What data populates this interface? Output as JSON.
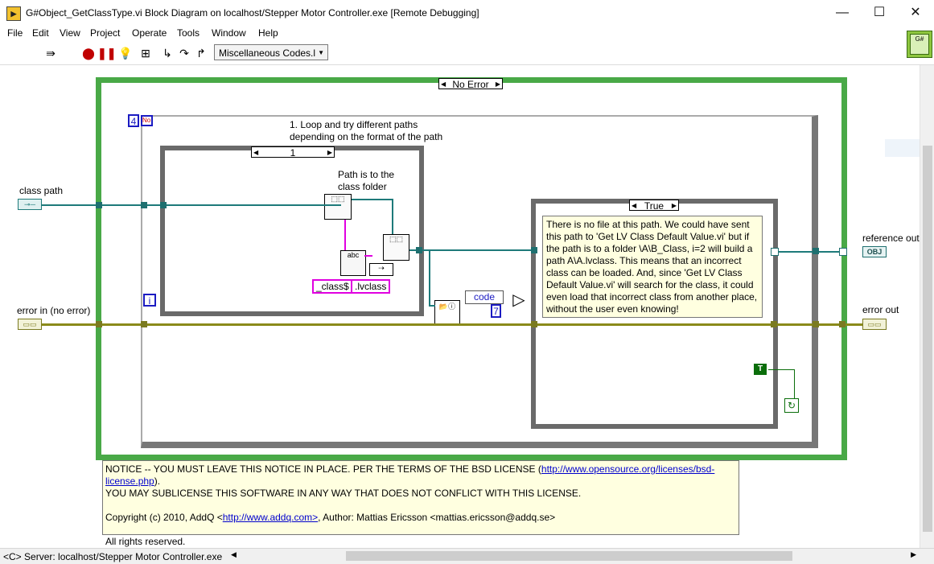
{
  "window": {
    "title": "G#Object_GetClassType.vi Block Diagram on localhost/Stepper Motor Controller.exe [Remote Debugging]",
    "minimize": "—",
    "maximize": "☐",
    "close": "✕"
  },
  "menu": [
    "File",
    "Edit",
    "View",
    "Project",
    "Operate",
    "Tools",
    "Window",
    "Help"
  ],
  "toolbar": {
    "font_select": "Miscellaneous Codes.l",
    "icons": [
      "run-continuous-icon",
      "abort-icon",
      "pause-icon",
      "highlight-execution-icon",
      "retain-wire-values-icon",
      "step-into-icon",
      "step-over-icon",
      "step-out-icon"
    ]
  },
  "diagram": {
    "outer_case_selector": "No Error",
    "loop_count_const": "4",
    "loop_stop": "No",
    "loop_iter": "i",
    "loop_comment": "1. Loop and try different paths\ndepending on the format of the path",
    "inner_case_selector": "1",
    "inner_comment": "Path is to the\nclass folder",
    "const_class": "_class$",
    "const_lvclass": ".lvclass",
    "true_case_selector": "True",
    "code_label": "code",
    "code_const": "7",
    "true_bool": "T",
    "true_case_note": "There is no file at this path. We could have sent this path to 'Get LV Class Default Value.vi' but if the path is to a folder \\A\\B_Class,  i=2 will build a path A\\A.lvclass. This means that an incorrect class can be loaded. And, since 'Get LV Class Default Value.vi' will search for the class, it could even load that incorrect class from another place, without the user even knowing!",
    "class_path_label": "class path",
    "error_in_label": "error in (no error)",
    "reference_out_label": "reference out",
    "error_out_label": "error out",
    "ref_out_badge": "OBJ"
  },
  "notice": {
    "line1_pre": "NOTICE -- YOU MUST LEAVE THIS NOTICE IN PLACE.  PER THE TERMS OF THE BSD LICENSE  (",
    "line1_link": "http://www.opensource.org/licenses/bsd-license.php",
    "line1_post": ").",
    "line2": "YOU MAY SUBLICENSE THIS SOFTWARE IN ANY WAY THAT DOES NOT CONFLICT WITH THIS LICENSE.",
    "line3_pre": "Copyright (c) 2010, AddQ <",
    "line3_link": "http://www.addq.com>",
    "line3_post": ", Author: Mattias Ericsson <mattias.ericsson@addq.se>",
    "line4": "All rights reserved."
  },
  "status": {
    "server": "<C> Server: localhost/Stepper Motor Controller.exe"
  },
  "colors": {
    "case_green": "#49a947",
    "wire_teal": "#1e7a7a",
    "wire_error": "#8a8a1a",
    "wire_string": "#e000e0",
    "note_bg": "#ffffe0"
  }
}
